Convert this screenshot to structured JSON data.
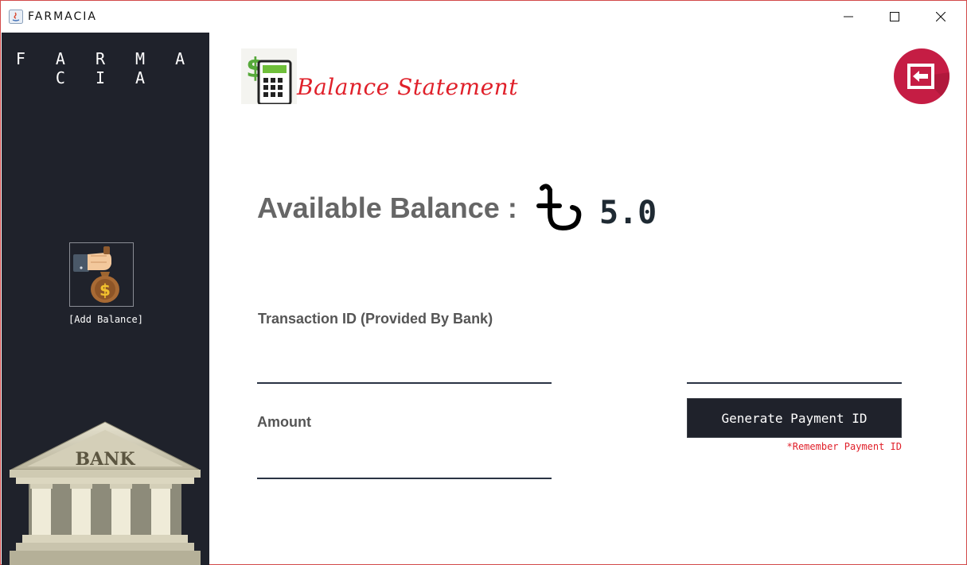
{
  "window": {
    "title": "FARMACIA",
    "controls": {
      "minimize": "minimize-icon",
      "maximize": "maximize-icon",
      "close": "close-icon"
    }
  },
  "sidebar": {
    "brand": "F A R M A C I A",
    "add_balance": {
      "label": "[Add Balance]",
      "icon": "money-bag-hand-icon"
    },
    "bank_image": {
      "icon": "bank-building-icon",
      "text": "BANK"
    }
  },
  "header": {
    "title": "Balance Statement",
    "icon": "calculator-dollar-icon",
    "back_icon": "exit-arrow-icon"
  },
  "balance": {
    "label": "Available Balance :",
    "currency_icon": "taka-icon",
    "value": "5.0"
  },
  "form": {
    "transaction_label": "Transaction ID (Provided By Bank)",
    "transaction_value": "",
    "amount_label": "Amount",
    "amount_value": "",
    "payment_id_value": "",
    "generate_button": "Generate Payment ID",
    "note": "*Remember Payment ID"
  },
  "colors": {
    "sidebar_bg": "#1f222b",
    "accent_red": "#e0202a",
    "back_button": "#c51d44",
    "button_bg": "#1f222b"
  }
}
